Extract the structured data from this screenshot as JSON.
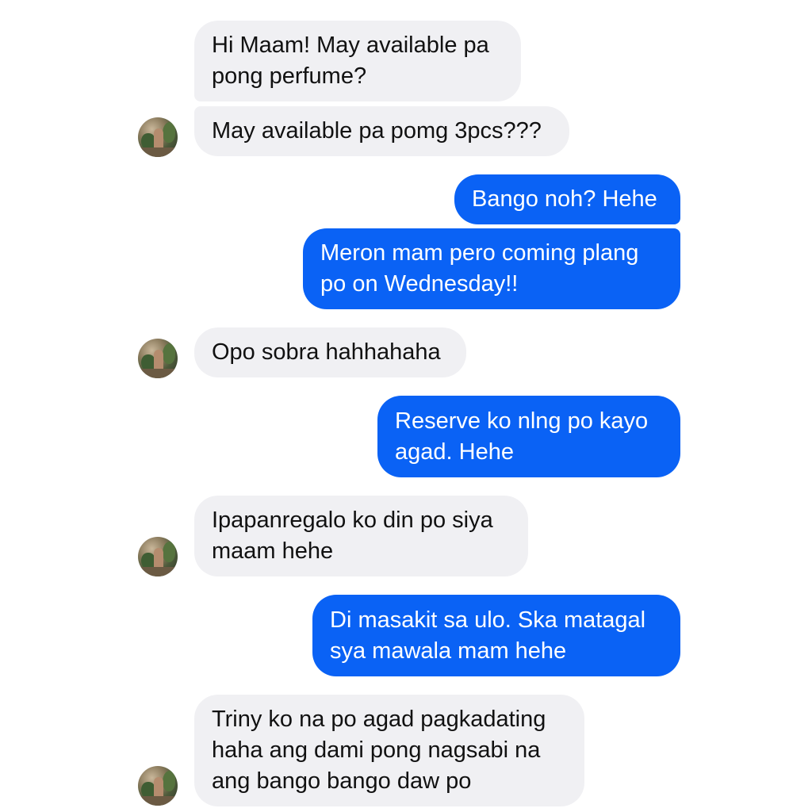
{
  "messages": [
    {
      "id": "m1",
      "side": "incoming",
      "text": "Hi Maam! May available pa\npong perfume?"
    },
    {
      "id": "m2",
      "side": "incoming",
      "text": "May available pa pomg 3pcs???"
    },
    {
      "id": "m3",
      "side": "outgoing",
      "text": "Bango noh? Hehe"
    },
    {
      "id": "m4",
      "side": "outgoing",
      "text": "Meron mam pero coming plang\npo on Wednesday!!"
    },
    {
      "id": "m5",
      "side": "incoming",
      "text": "Opo sobra hahhahaha"
    },
    {
      "id": "m6",
      "side": "outgoing",
      "text": "Reserve ko nlng po kayo\nagad. Hehe"
    },
    {
      "id": "m7",
      "side": "incoming",
      "text": "Ipapanregalo ko din po siya\nmaam hehe"
    },
    {
      "id": "m8",
      "side": "outgoing",
      "text": "Di masakit sa ulo. Ska matagal\nsya mawala mam hehe"
    },
    {
      "id": "m9",
      "side": "incoming",
      "text": "Triny ko na po agad pagkadating\nhaha ang dami pong nagsabi na\nang bango bango daw po"
    }
  ],
  "colors": {
    "incoming_bubble": "#f0f0f3",
    "outgoing_bubble": "#0a62f5",
    "incoming_text": "#111111",
    "outgoing_text": "#ffffff"
  },
  "icons": {
    "sender_avatar": "avatar-photo-icon"
  }
}
